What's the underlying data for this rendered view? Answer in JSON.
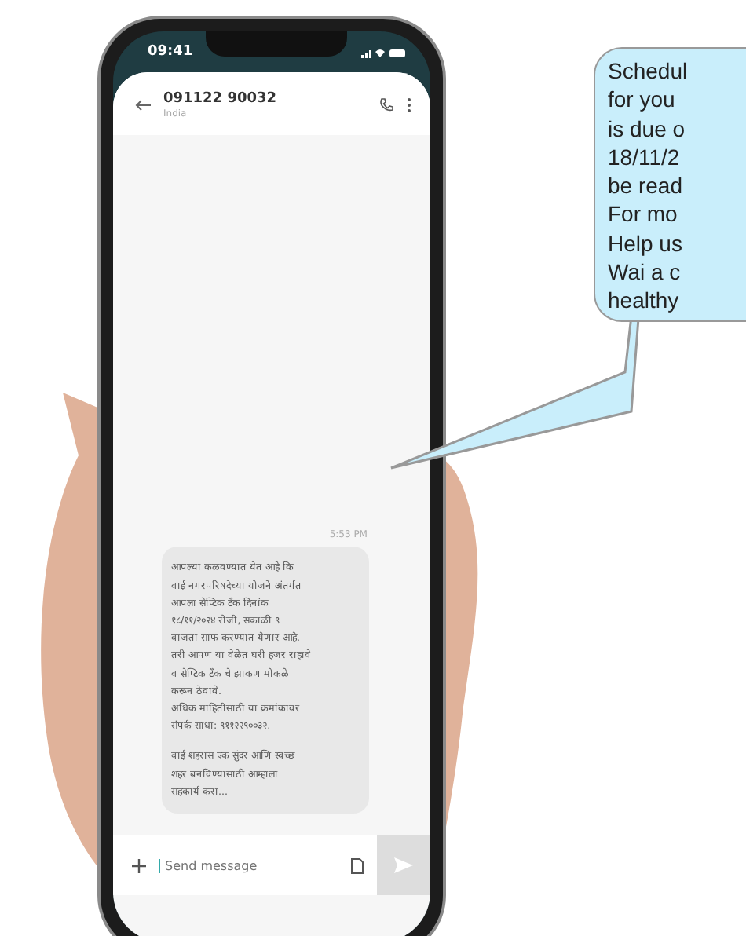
{
  "status_bar": {
    "time": "09:41"
  },
  "conversation": {
    "contact": "091122 90032",
    "subtitle": "India"
  },
  "messages": [
    {
      "time": "5:53 PM",
      "paragraphs": [
        [
          "आपल्या कळवण्यात येत आहे कि",
          "वाई नगरपरिषदेच्या योजने अंतर्गत",
          "आपला सेप्टिक टँक दिनांक",
          "१८/११/२०२४ रोजी, सकाळी ९",
          "वाजता साफ करण्यात येणार आहे.",
          "तरी आपण या वेळेत घरी हजर राहावे",
          "व सेप्टिक टँक चे झाकण मोकळे",
          "करून ठेवावे.",
          "अधिक माहितीसाठी या क्रमांकावर",
          "संपर्क साधा: ९११२२९००३२."
        ],
        [
          "वाई शहरास एक सुंदर आणि स्वच्छ",
          "शहर बनविण्यासाठी आम्हाला",
          "सहकार्य करा..."
        ]
      ]
    }
  ],
  "composer": {
    "placeholder": "Send message"
  },
  "callout": {
    "lines": [
      "Schedul",
      "for you",
      "is due o",
      "18/11/2",
      "be read",
      "For mo",
      "Help us",
      "Wai a c",
      "healthy"
    ]
  }
}
